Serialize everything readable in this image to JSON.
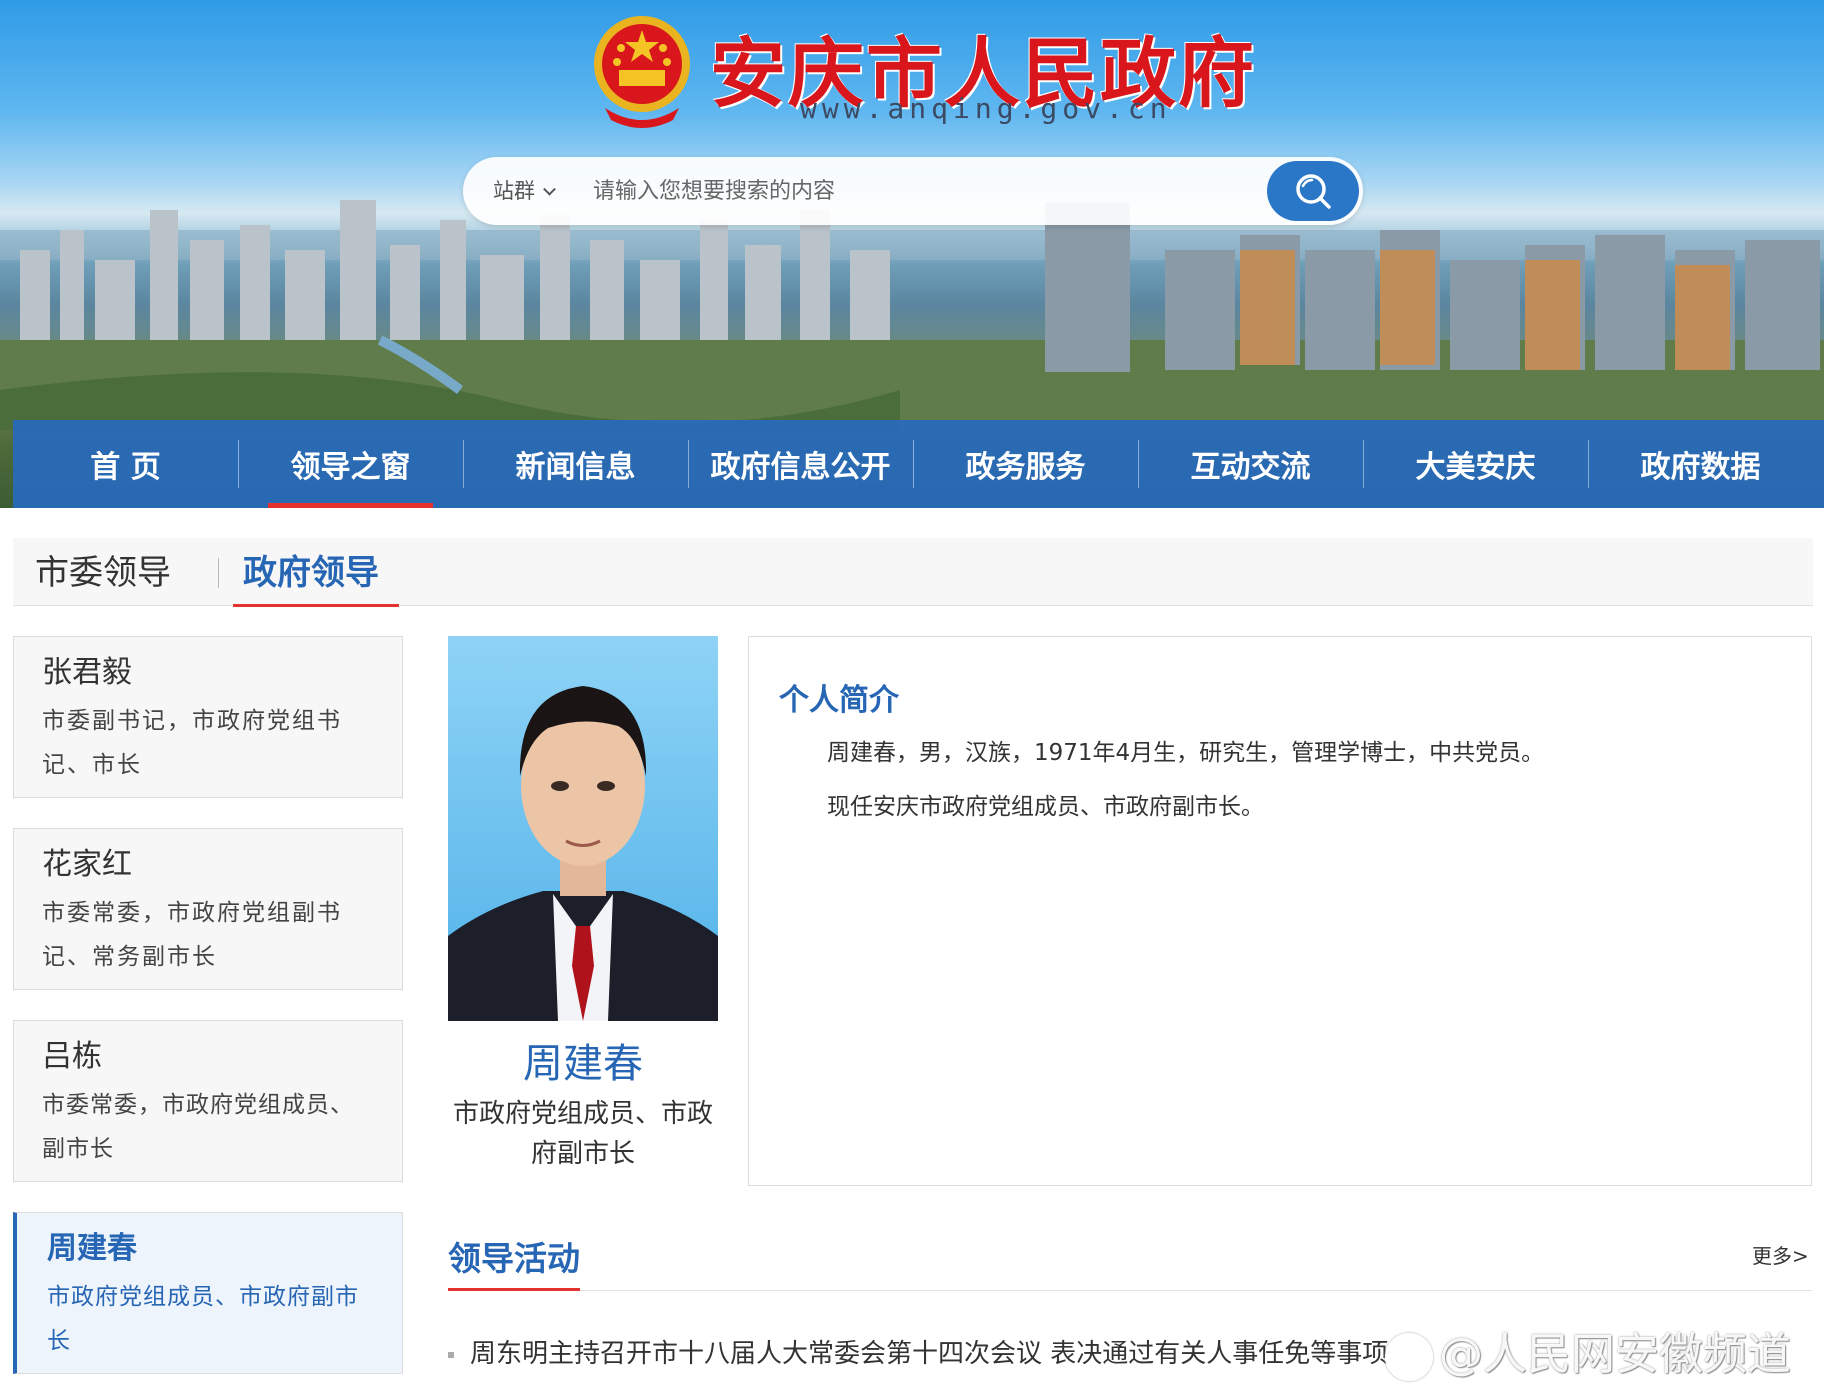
{
  "header": {
    "site_title": "安庆市人民政府",
    "site_url": "www.anqing.gov.cn"
  },
  "search": {
    "scope_label": "站群",
    "placeholder": "请输入您想要搜索的内容",
    "button_icon": "search-icon"
  },
  "nav": {
    "items": [
      {
        "label": "首 页"
      },
      {
        "label": "领导之窗",
        "active": true
      },
      {
        "label": "新闻信息"
      },
      {
        "label": "政府信息公开"
      },
      {
        "label": "政务服务"
      },
      {
        "label": "互动交流"
      },
      {
        "label": "大美安庆"
      },
      {
        "label": "政府数据"
      }
    ]
  },
  "tabs": [
    {
      "label": "市委领导"
    },
    {
      "label": "政府领导",
      "active": true
    }
  ],
  "leaders": [
    {
      "name": "张君毅",
      "position": "市委副书记，市政府党组书记、市长"
    },
    {
      "name": "花家红",
      "position": "市委常委，市政府党组副书记、常务副市长"
    },
    {
      "name": "吕栋",
      "position": "市委常委，市政府党组成员、副市长"
    },
    {
      "name": "周建春",
      "position": "市政府党组成员、市政府副市长",
      "active": true
    }
  ],
  "profile": {
    "name": "周建春",
    "position": "市政府党组成员、市政府副市长",
    "bio_title": "个人简介",
    "bio_paragraphs": [
      "周建春，男，汉族，1971年4月生，研究生，管理学博士，中共党员。",
      "现任安庆市政府党组成员、市政府副市长。"
    ]
  },
  "activities": {
    "title": "领导活动",
    "more_label": "更多>",
    "items": [
      {
        "title": "周东明主持召开市十八届人大常委会第十四次会议 表决通过有关人事任免等事项"
      }
    ]
  },
  "watermark": {
    "text": "@人民网安徽频道"
  },
  "colors": {
    "brand_red": "#d8161b",
    "nav_blue": "#276abe",
    "accent_blue": "#2766b4",
    "active_underline": "#e4322e"
  }
}
